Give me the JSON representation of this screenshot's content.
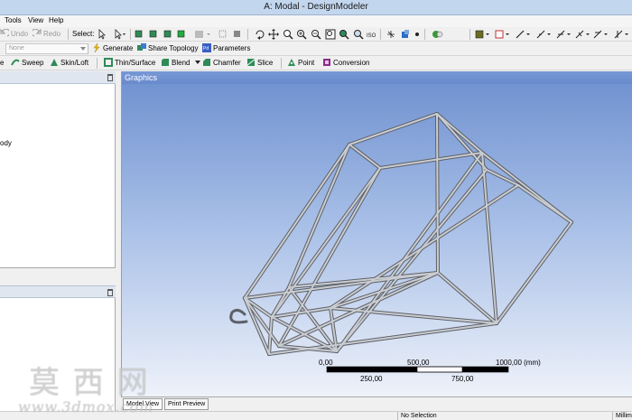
{
  "window": {
    "title": "A: Modal - DesignModeler"
  },
  "menu": [
    "Tools",
    "View",
    "Help"
  ],
  "toolbar1": {
    "undo": "Undo",
    "redo": "Redo",
    "select_label": "Select:"
  },
  "toolbar2": {
    "mode_value": "None",
    "generate": "Generate",
    "share_topology": "Share Topology",
    "parameters": "Parameters"
  },
  "toolbar3": {
    "extrude_cut": "e",
    "sweep": "Sweep",
    "skin_loft": "Skin/Loft",
    "thin_surface": "Thin/Surface",
    "blend": "Blend",
    "chamfer": "Chamfer",
    "slice": "Slice",
    "point": "Point",
    "conversion": "Conversion"
  },
  "tree": {
    "item_fragment": "ody"
  },
  "graphics": {
    "title": "Graphics"
  },
  "scale": {
    "top_labels": [
      "0,00",
      "500,00",
      "1000,00 (mm)"
    ],
    "bottom_labels": [
      "250,00",
      "750,00"
    ]
  },
  "tabs": [
    "Model View",
    "Print Preview"
  ],
  "status": {
    "selection": "No Selection",
    "units": "Millim"
  },
  "watermark": {
    "chars": "莫 西 网",
    "url": "www.3dmox.com"
  }
}
